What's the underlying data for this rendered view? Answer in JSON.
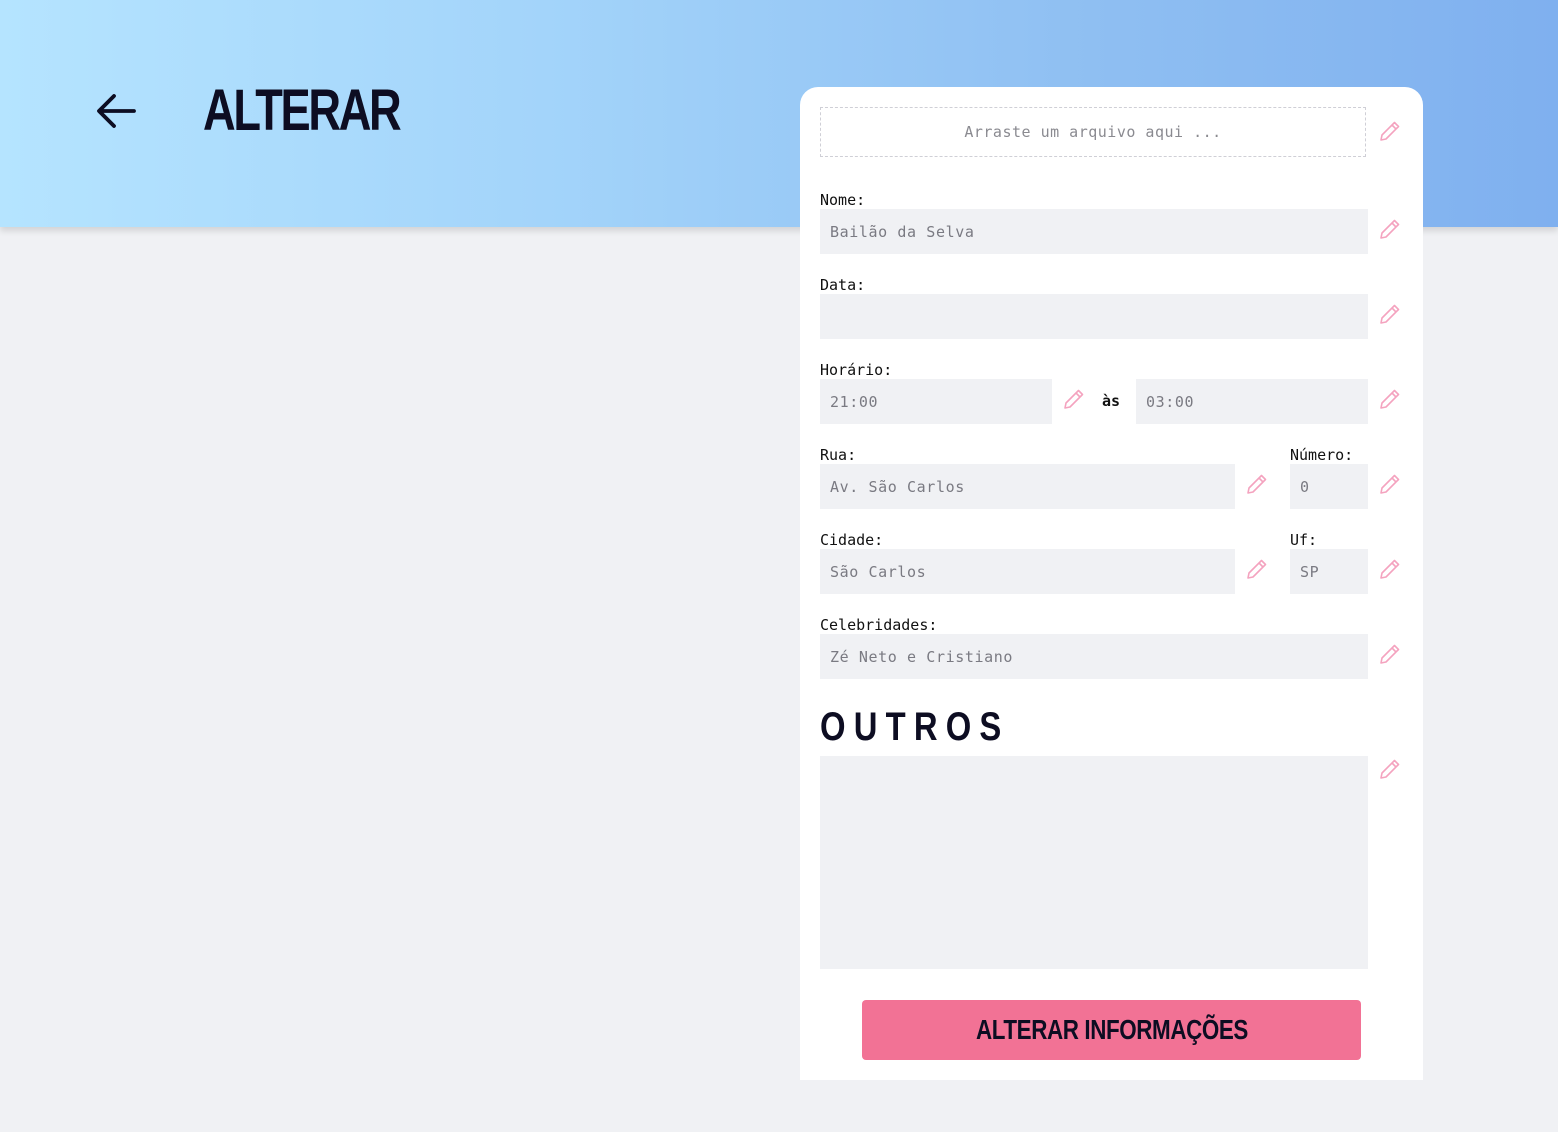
{
  "page": {
    "title": "ALTERAR",
    "back_icon": "arrow-left-icon"
  },
  "form": {
    "dropzone_text": "Arraste um arquivo aqui ...",
    "name": {
      "label": "Nome:",
      "value": "Bailão da Selva"
    },
    "date": {
      "label": "Data:",
      "value": ""
    },
    "time": {
      "label": "Horário:",
      "start": "21:00",
      "separator": "às",
      "end": "03:00"
    },
    "street": {
      "label": "Rua:",
      "value": "Av. São Carlos"
    },
    "number": {
      "label": "Número:",
      "value": "0"
    },
    "city": {
      "label": "Cidade:",
      "value": "São Carlos"
    },
    "state": {
      "label": "Uf:",
      "value": "SP"
    },
    "celebrities": {
      "label": "Celebridades:",
      "value": "Zé Neto e Cristiano"
    },
    "others": {
      "title": "OUTROS",
      "value": ""
    },
    "submit_label": "ALTERAR INFORMAÇÕES",
    "edit_icon": "pencil-icon"
  },
  "colors": {
    "header_start": "#b5e4ff",
    "header_end": "#7fb0ef",
    "accent": "#f27295",
    "pencil": "#f4a3bf",
    "input_bg": "#f0f1f4",
    "title": "#0d0d22"
  }
}
